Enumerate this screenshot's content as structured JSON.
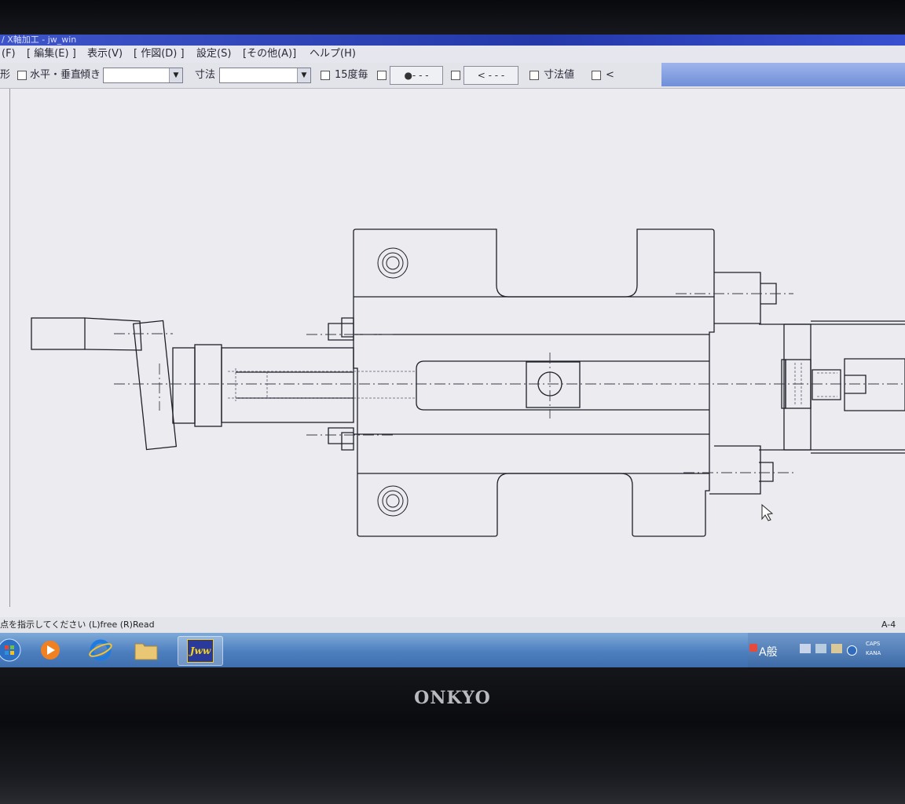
{
  "window": {
    "title": "/ X軸加工 - jw_win"
  },
  "menu": [
    "(F)",
    "[ 編集(E) ]",
    "表示(V)",
    "[ 作図(D) ]",
    "設定(S)",
    "[その他(A)]",
    "ヘルプ(H)"
  ],
  "toolbar": {
    "shape_label": "形",
    "horiz_vert_label": "水平・垂直",
    "tilt_label": "傾き",
    "dimension_label": "寸法",
    "deg15_label": "15度毎",
    "line_style_btn1": "●- - -",
    "line_style_btn2": "< - - -",
    "dim_value_label": "寸法値",
    "last_label": "<"
  },
  "status": {
    "prompt": "点を指示してください (L)free (R)Read",
    "sheet": "A-4"
  },
  "tray": {
    "ime": "A般",
    "caps": "CAPS",
    "kana": "KANA"
  },
  "bezel": {
    "brand": "ONKYO"
  },
  "icons": {
    "start": "windows-start-icon",
    "media": "media-player-icon",
    "ie": "internet-explorer-icon",
    "folder": "folder-icon",
    "jww": "jww-app-icon"
  },
  "taskbar_app": "Jww",
  "colors": {
    "line": "#1e1e28",
    "canvas": "#ececf0",
    "taskbar": "#4d7fbf"
  }
}
